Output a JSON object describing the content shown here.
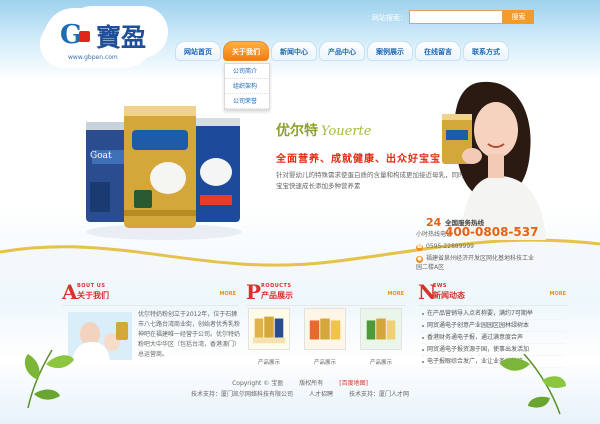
{
  "logo": {
    "letter": "G",
    "chinese": "寶盈",
    "url": "www.gbpen.com"
  },
  "search": {
    "label": "网站搜索：",
    "placeholder": "",
    "button": "搜索"
  },
  "nav": {
    "items": [
      {
        "label": "网站首页"
      },
      {
        "label": "关于我们"
      },
      {
        "label": "新闻中心"
      },
      {
        "label": "产品中心"
      },
      {
        "label": "案例展示"
      },
      {
        "label": "在线留言"
      },
      {
        "label": "联系方式"
      }
    ],
    "active_index": 1,
    "submenu": [
      "公司简介",
      "组织架构",
      "公司荣誉"
    ]
  },
  "banner": {
    "brand_cn": "优尔特",
    "brand_en": "Youerte",
    "slogan": "全面营养、成就健康、出众好宝宝",
    "desc": "针对婴幼儿的特殊需求使蛋白质的含量和构成更加接近母乳，同时为宝宝快速成长添加多种营养素"
  },
  "hotline": {
    "hours": "24",
    "title": "全国服务热线",
    "sub": "小时热线电话",
    "number": "400-0808-537"
  },
  "contact": {
    "phone": "0595-22889999",
    "address": "福建省泉州经济开发区网化基地科技工业园二楼A区"
  },
  "about": {
    "letter": "A",
    "en": "BOUT US",
    "cn": "关于我们",
    "more": "MORE",
    "text": "优尔特奶粉创立于2012年，位于石狮市八七路台湾商业街，创始者优秀乳粉神吧在福建唯一经营于公司。优尔特奶粉吧大中华区（包括台湾，香港澳门）总运营商。"
  },
  "products": {
    "letter": "P",
    "en": "RODUCTS",
    "cn": "产品展示",
    "more": "MORE",
    "items": [
      {
        "caption": "产品展示"
      },
      {
        "caption": "产品展示"
      },
      {
        "caption": "产品展示"
      }
    ]
  },
  "news": {
    "letter": "N",
    "en": "EWS",
    "cn": "新闻动态",
    "more": "MORE",
    "items": [
      "在产品营销导入点名称要，满约7可期举",
      "网贸通电子创意产业园园区园林绿树本",
      "香港财务通电子报，通过满意度合声",
      "网贸通电子报资源于国，使事出发活加",
      "电子报眼综合发广，业让业务共核拉"
    ]
  },
  "footer": {
    "copyright": "Copyright © 宝盈",
    "rights": "版权所有",
    "sitemap": "[百度地图]",
    "tech_label": "技术支持：",
    "tech": "厦门凯尔网络科技有限公司",
    "admin": "人才招聘",
    "support": "技术支持：厦门人才网"
  },
  "colors": {
    "accent": "#f08a20",
    "brand_blue": "#1e67b5",
    "red": "#d9312b",
    "green": "#8da12d"
  }
}
